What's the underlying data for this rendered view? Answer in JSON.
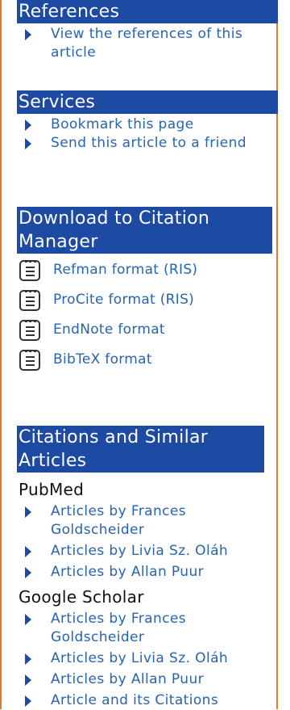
{
  "references": {
    "header": "References",
    "items": [
      "View the references of this article"
    ]
  },
  "services": {
    "header": "Services",
    "items": [
      "Bookmark this page",
      "Send this article to a friend"
    ]
  },
  "citation_manager": {
    "header": "Download to Citation Manager",
    "items": [
      "Refman format (RIS)",
      "ProCite format (RIS)",
      "EndNote format",
      "BibTeX format"
    ],
    "icon": "document-icon"
  },
  "similar": {
    "header": "Citations and Similar Articles",
    "pubmed": {
      "label": "PubMed",
      "items": [
        "Articles by Frances Goldscheider",
        "Articles by Livia Sz. Oláh",
        "Articles by Allan Puur"
      ]
    },
    "scholar": {
      "label": "Google Scholar",
      "items": [
        "Articles by Frances Goldscheider",
        "Articles by Livia Sz. Oláh",
        "Articles by Allan Puur",
        "Article and its Citations"
      ]
    }
  },
  "colors": {
    "header_bg": "#1d4aa3",
    "link": "#2764b0",
    "border": "#e87722"
  }
}
